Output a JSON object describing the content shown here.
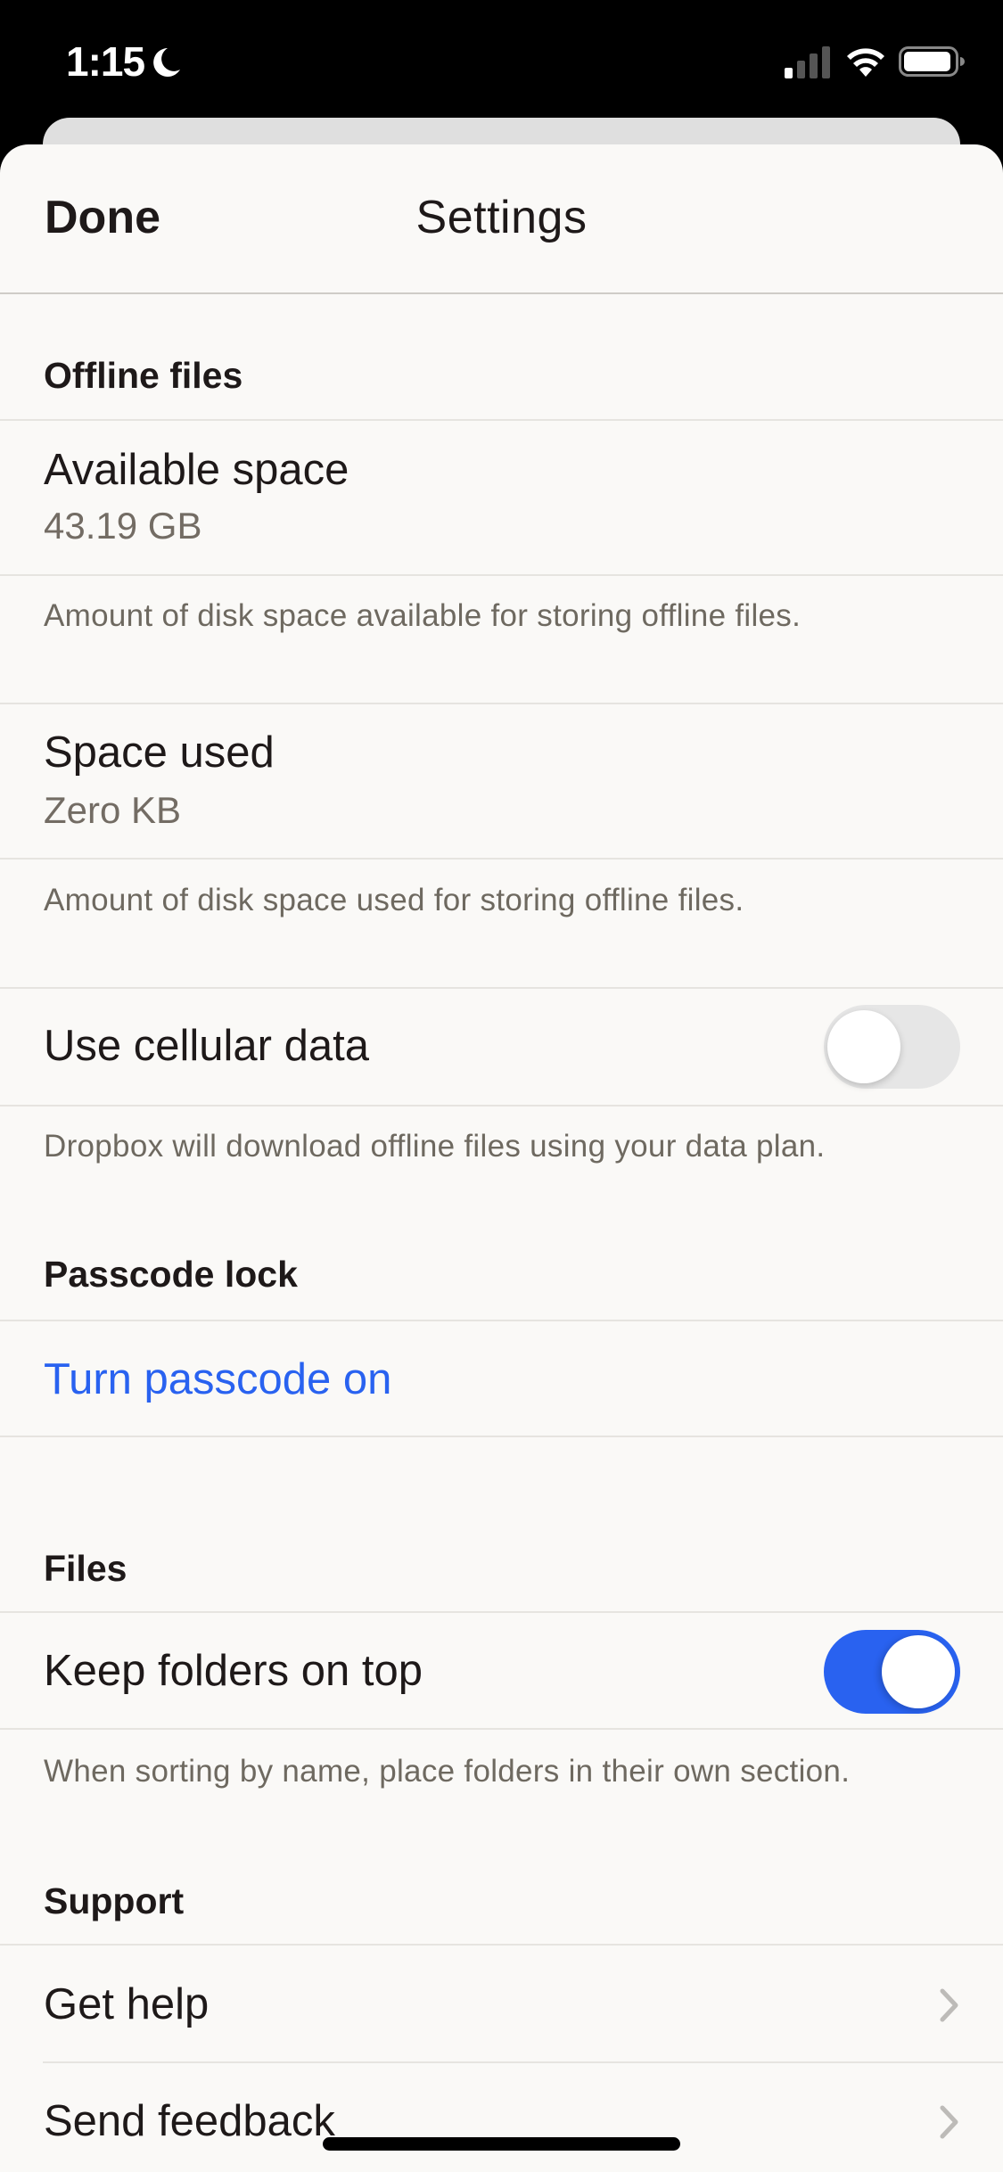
{
  "status_bar": {
    "time": "1:15",
    "focus_icon": "moon-icon",
    "signal_bars_active": 1,
    "signal_bars_total": 4,
    "wifi": "wifi-icon",
    "battery_level": 0.9
  },
  "nav": {
    "done_label": "Done",
    "title": "Settings"
  },
  "sections": {
    "offline_files": {
      "header": "Offline files",
      "available_space": {
        "label": "Available space",
        "value": "43.19 GB",
        "description": "Amount of disk space available for storing offline files."
      },
      "space_used": {
        "label": "Space used",
        "value": "Zero KB",
        "description": "Amount of disk space used for storing offline files."
      },
      "cellular": {
        "label": "Use cellular data",
        "enabled": false,
        "description": "Dropbox will download offline files using your data plan."
      }
    },
    "passcode": {
      "header": "Passcode lock",
      "action_label": "Turn passcode on"
    },
    "files": {
      "header": "Files",
      "folders_on_top": {
        "label": "Keep folders on top",
        "enabled": true,
        "description": "When sorting by name, place folders in their own section."
      }
    },
    "support": {
      "header": "Support",
      "items": [
        {
          "label": "Get help",
          "icon": "chevron-right-icon"
        },
        {
          "label": "Send feedback",
          "icon": "chevron-right-icon"
        }
      ]
    }
  },
  "colors": {
    "accent": "#2962f0",
    "background": "#faf9f7",
    "text_primary": "#1e1919",
    "text_secondary": "#736c64",
    "toggle_off": "#e6e6e6"
  }
}
